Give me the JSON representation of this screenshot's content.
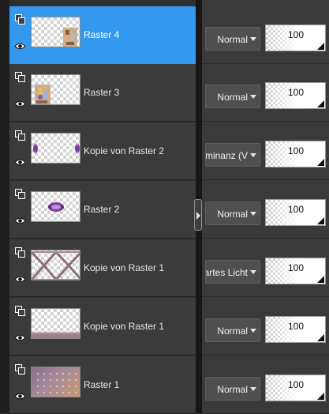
{
  "panel": {
    "colors": {
      "background": "#2f2f2f",
      "row": "#3b3b3b",
      "selected_row": "#3598ef",
      "separator": "#161616",
      "dropdown": "#4f4f4f"
    },
    "icons": {
      "stack": "layer-stack-icon",
      "visibility": "eye-icon",
      "dropdown": "chevron-down-icon",
      "splitter": "chevron-right-icon"
    }
  },
  "layers": [
    {
      "name": "Raster 4",
      "selected": true,
      "blend_mode": "Normal",
      "opacity": "100"
    },
    {
      "name": "Raster 3",
      "selected": false,
      "blend_mode": "Normal",
      "opacity": "100"
    },
    {
      "name": "Kopie von Raster 2",
      "selected": false,
      "blend_mode": "Luminanz (V",
      "opacity": "100"
    },
    {
      "name": "Raster 2",
      "selected": false,
      "blend_mode": "Normal",
      "opacity": "100"
    },
    {
      "name": "Kopie von Raster 1",
      "selected": false,
      "blend_mode": "Hartes Licht",
      "opacity": "100"
    },
    {
      "name": "Kopie von Raster 1",
      "selected": false,
      "blend_mode": "Normal",
      "opacity": "100"
    },
    {
      "name": "Raster 1",
      "selected": false,
      "blend_mode": "Normal",
      "opacity": "100"
    }
  ]
}
